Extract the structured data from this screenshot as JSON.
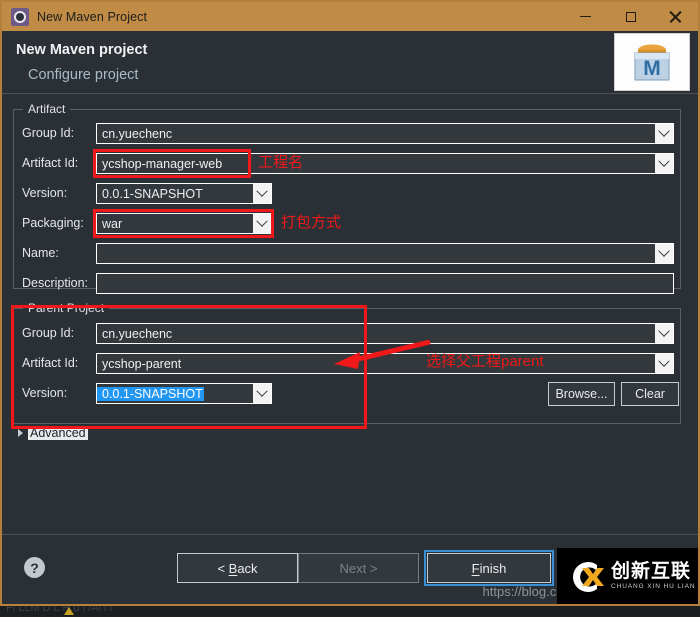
{
  "window": {
    "title": "New Maven Project",
    "icon": "gear-icon",
    "controls": {
      "minimize": "minimize-icon",
      "maximize": "maximize-icon",
      "close": "close-icon"
    }
  },
  "header": {
    "title": "New Maven project",
    "subtitle": "Configure project",
    "logo_letter": "M",
    "logo_name": "maven-logo"
  },
  "artifact": {
    "legend": "Artifact",
    "fields": [
      {
        "label": "Group Id:",
        "value": "cn.yuechenc",
        "combo": true
      },
      {
        "label": "Artifact Id:",
        "value": "ycshop-manager-web",
        "combo": true
      },
      {
        "label": "Version:",
        "value": "0.0.1-SNAPSHOT",
        "combo": true
      },
      {
        "label": "Packaging:",
        "value": "war",
        "combo": true
      },
      {
        "label": "Name:",
        "value": "",
        "combo": true
      },
      {
        "label": "Description:",
        "value": "",
        "combo": false
      }
    ]
  },
  "parent": {
    "legend": "Parent Project",
    "fields": [
      {
        "label": "Group Id:",
        "value": "cn.yuechenc",
        "combo": true
      },
      {
        "label": "Artifact Id:",
        "value": "ycshop-parent",
        "combo": true
      },
      {
        "label": "Version:",
        "value": "0.0.1-SNAPSHOT",
        "combo": true,
        "selected": true
      }
    ],
    "browse_label": "Browse...",
    "clear_label": "Clear"
  },
  "advanced": {
    "label": "Advanced"
  },
  "annotations": {
    "artifact_id_note": "工程名",
    "packaging_note": "打包方式",
    "parent_note": "选择父工程parent",
    "color": "#f01818"
  },
  "footer": {
    "help": "?",
    "back": "< Back",
    "back_prefix": "< ",
    "back_mnemonic": "B",
    "back_suffix": "ack",
    "next": "Next >",
    "finish_mnemonic": "F",
    "finish_suffix": "inish",
    "finish": "Finish",
    "watermark": "https://blog.csd"
  },
  "brand": {
    "cn": "创新互联",
    "pinyin": "CHUANG XIN HU LIAN"
  },
  "statusbar": {
    "text": "Fi  LLM D  L  R  d  i  /Al  l  t"
  },
  "colors": {
    "titlebar": "#c08b45",
    "window_border": "#b4803b",
    "panel": "#2b3036",
    "accent_focus": "#3a8fd8",
    "selection": "#2196f3",
    "annotation": "#f01818"
  }
}
